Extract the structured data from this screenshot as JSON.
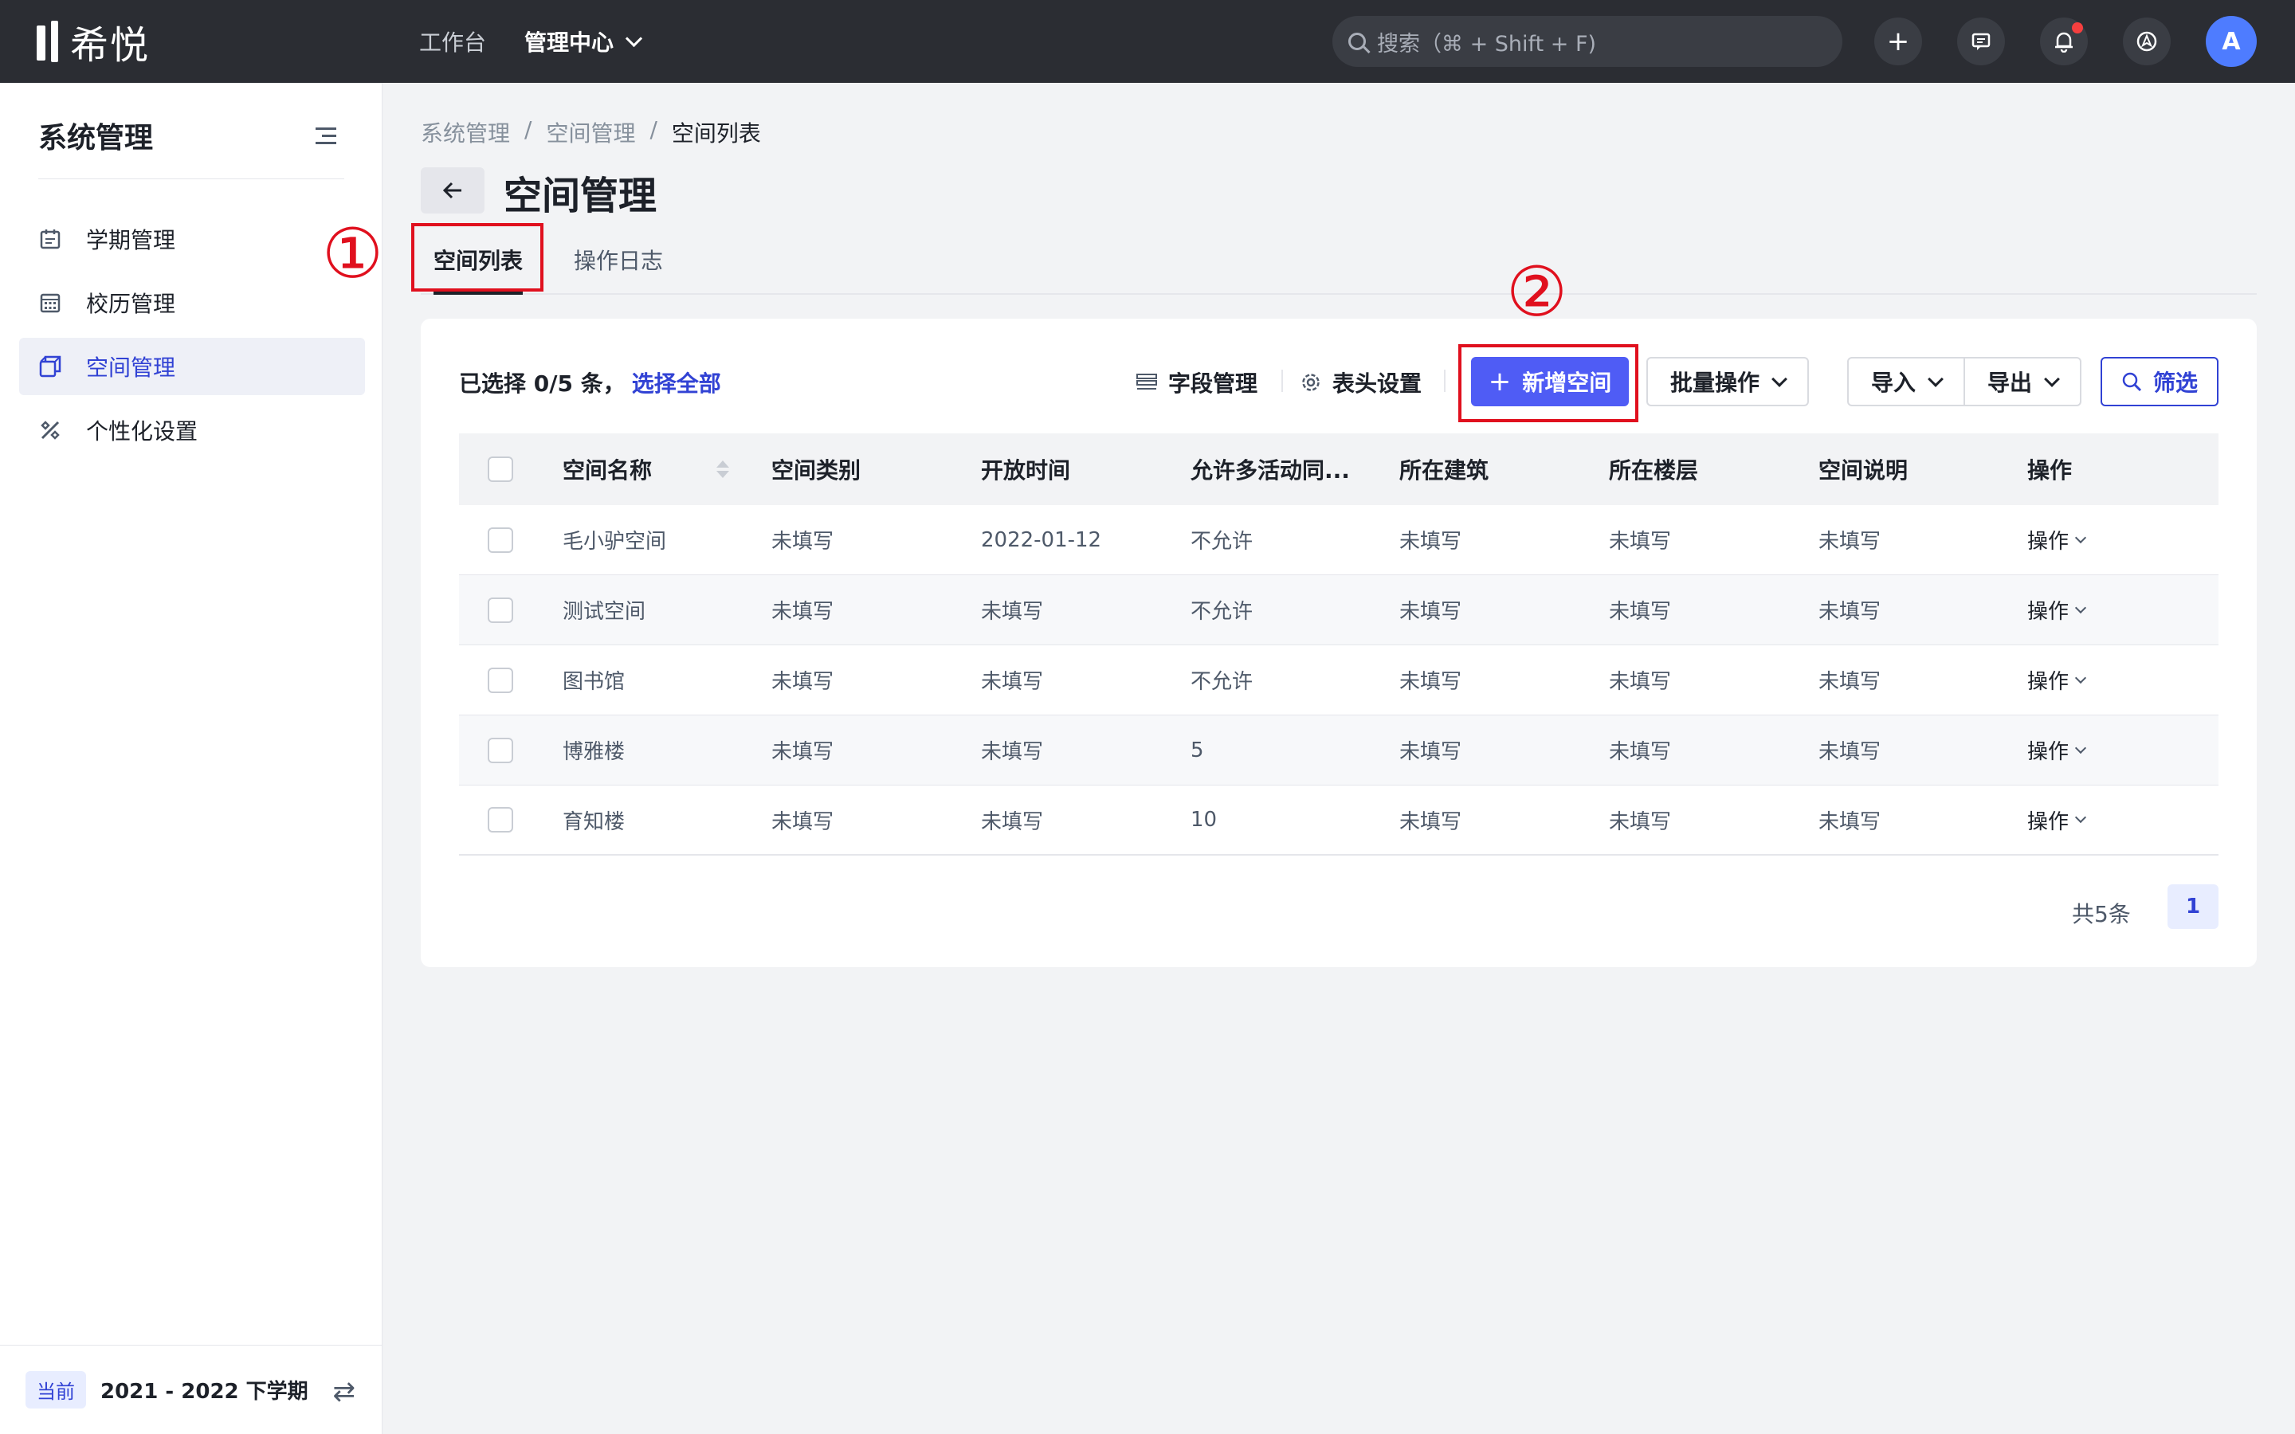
{
  "topbar": {
    "logo_text": "希悦",
    "nav": [
      {
        "label": "工作台"
      },
      {
        "label": "管理中心"
      }
    ],
    "search_placeholder": "搜索（⌘ + Shift + F)",
    "avatar_letter": "A"
  },
  "sidebar": {
    "title": "系统管理",
    "items": [
      {
        "label": "学期管理",
        "icon": "calendar-icon"
      },
      {
        "label": "校历管理",
        "icon": "grid-calendar-icon"
      },
      {
        "label": "空间管理",
        "icon": "cube-icon"
      },
      {
        "label": "个性化设置",
        "icon": "tools-icon"
      }
    ],
    "footer": {
      "tag": "当前",
      "term": "2021 - 2022 下学期"
    }
  },
  "breadcrumb": [
    "系统管理",
    "空间管理",
    "空间列表"
  ],
  "page_title": "空间管理",
  "tabs": [
    {
      "label": "空间列表"
    },
    {
      "label": "操作日志"
    }
  ],
  "annotations": {
    "one": "①",
    "two": "②"
  },
  "toolbar": {
    "selected_text": "已选择 0/5 条，",
    "select_all": "选择全部",
    "field_manage": "字段管理",
    "header_settings": "表头设置",
    "add_space": "新增空间",
    "batch_ops": "批量操作",
    "import": "导入",
    "export": "导出",
    "filter": "筛选"
  },
  "table": {
    "headers": [
      "空间名称",
      "空间类别",
      "开放时间",
      "允许多活动同...",
      "所在建筑",
      "所在楼层",
      "空间说明",
      "操作"
    ],
    "rows": [
      [
        "毛小驴空间",
        "未填写",
        "2022-01-12",
        "不允许",
        "未填写",
        "未填写",
        "未填写",
        "操作"
      ],
      [
        "测试空间",
        "未填写",
        "未填写",
        "不允许",
        "未填写",
        "未填写",
        "未填写",
        "操作"
      ],
      [
        "图书馆",
        "未填写",
        "未填写",
        "不允许",
        "未填写",
        "未填写",
        "未填写",
        "操作"
      ],
      [
        "博雅楼",
        "未填写",
        "未填写",
        "5",
        "未填写",
        "未填写",
        "未填写",
        "操作"
      ],
      [
        "育知楼",
        "未填写",
        "未填写",
        "10",
        "未填写",
        "未填写",
        "未填写",
        "操作"
      ]
    ]
  },
  "pagination": {
    "total": "共5条",
    "current": "1"
  },
  "colors": {
    "primary": "#4f5cf5",
    "accent_text": "#3142d4",
    "annotation": "#e0101e",
    "topbar": "#2b2d33"
  }
}
